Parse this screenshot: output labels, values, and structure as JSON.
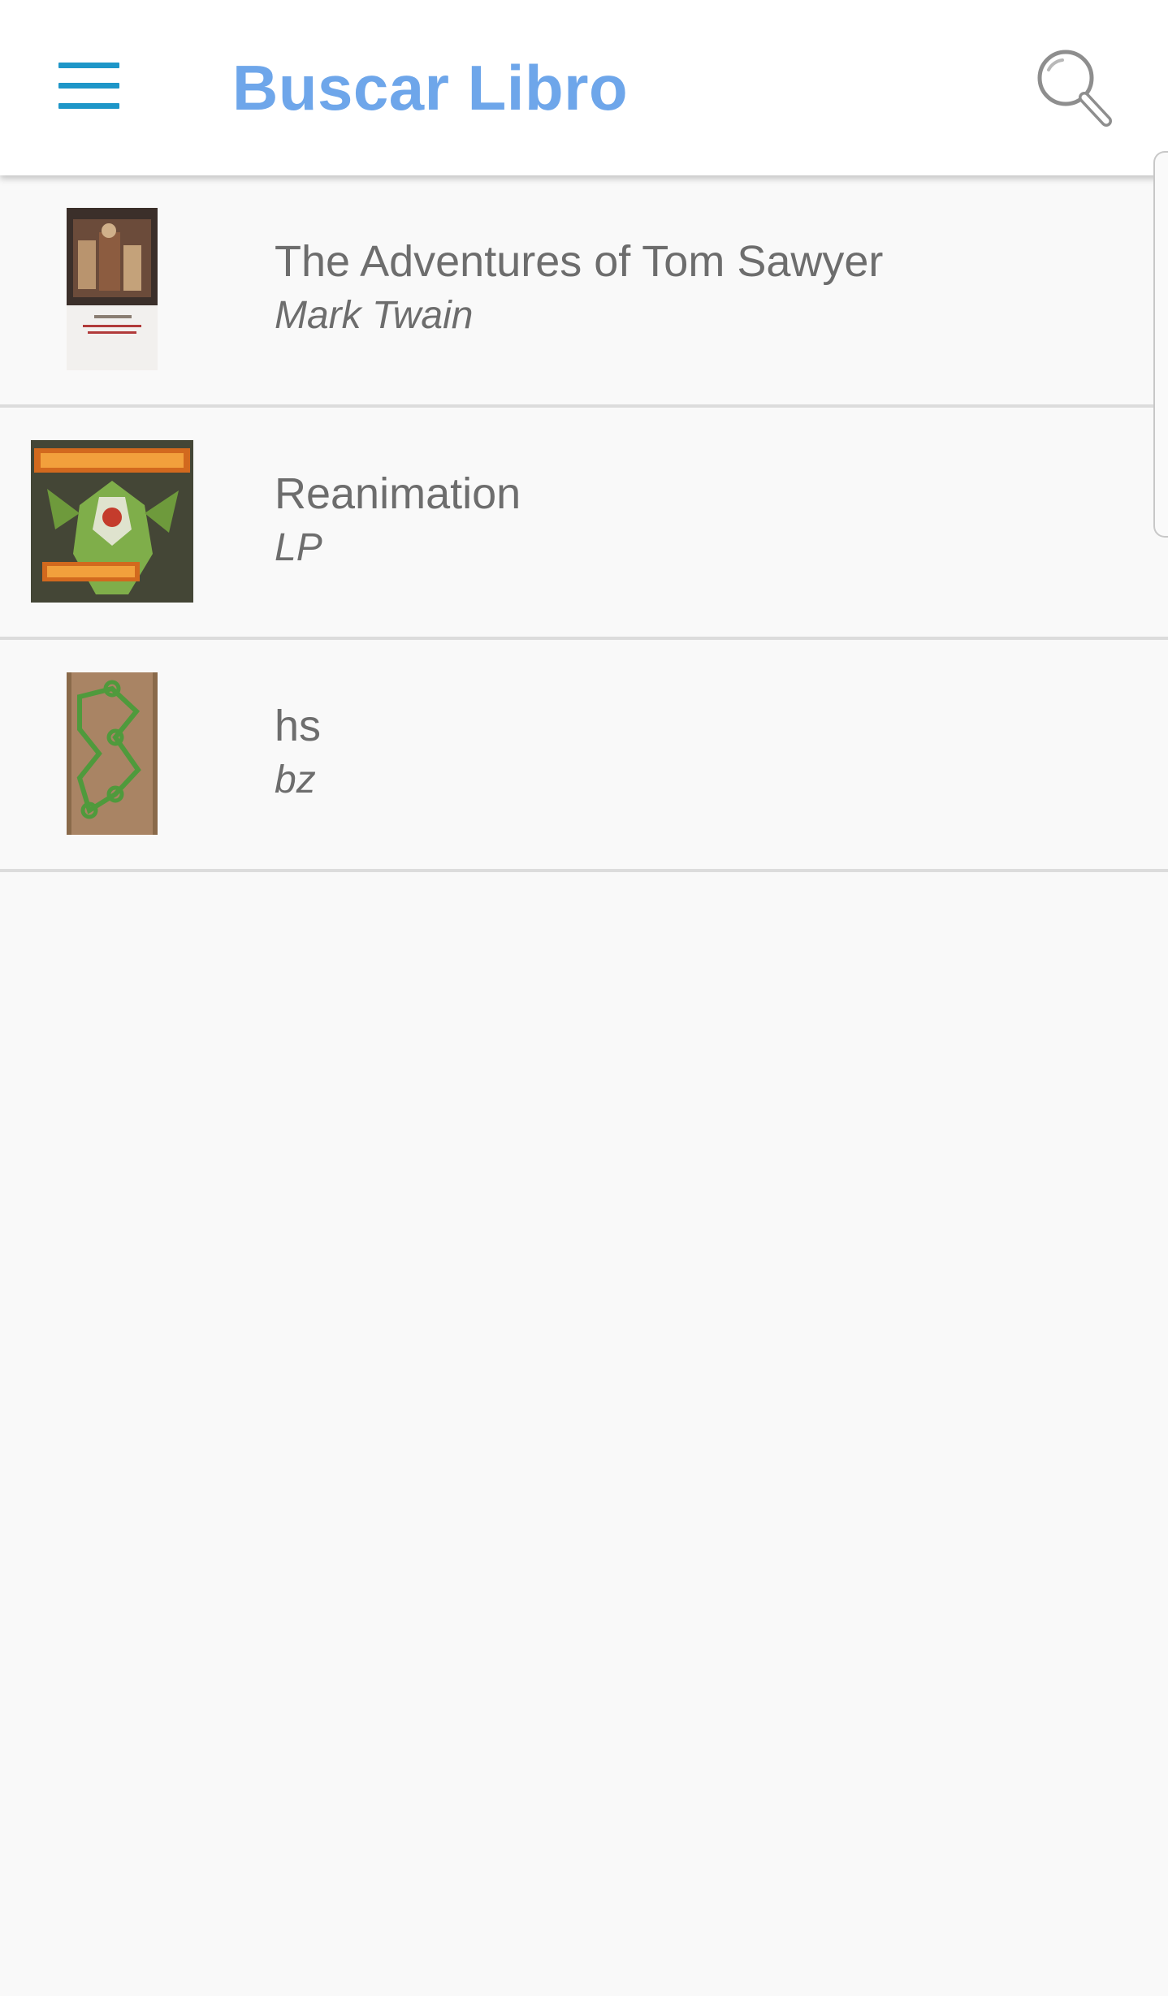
{
  "app_bar": {
    "title": "Buscar Libro",
    "title_color": "#6ea6ea",
    "menu_icon": "hamburger-menu-icon",
    "menu_color": "#1e96c8",
    "search_icon": "magnifier-search-icon"
  },
  "books": [
    {
      "title": "The Adventures of Tom Sawyer",
      "author": "Mark Twain",
      "cover_icon": "book-cover-tom-sawyer"
    },
    {
      "title": "Reanimation",
      "author": "LP",
      "cover_icon": "album-cover-reanimation"
    },
    {
      "title": "hs",
      "author": "bz",
      "cover_icon": "photo-cover-notebook"
    }
  ],
  "colors": {
    "background": "#f9f9f9",
    "divider": "#dcdcdc",
    "text": "#6d6d6d"
  }
}
